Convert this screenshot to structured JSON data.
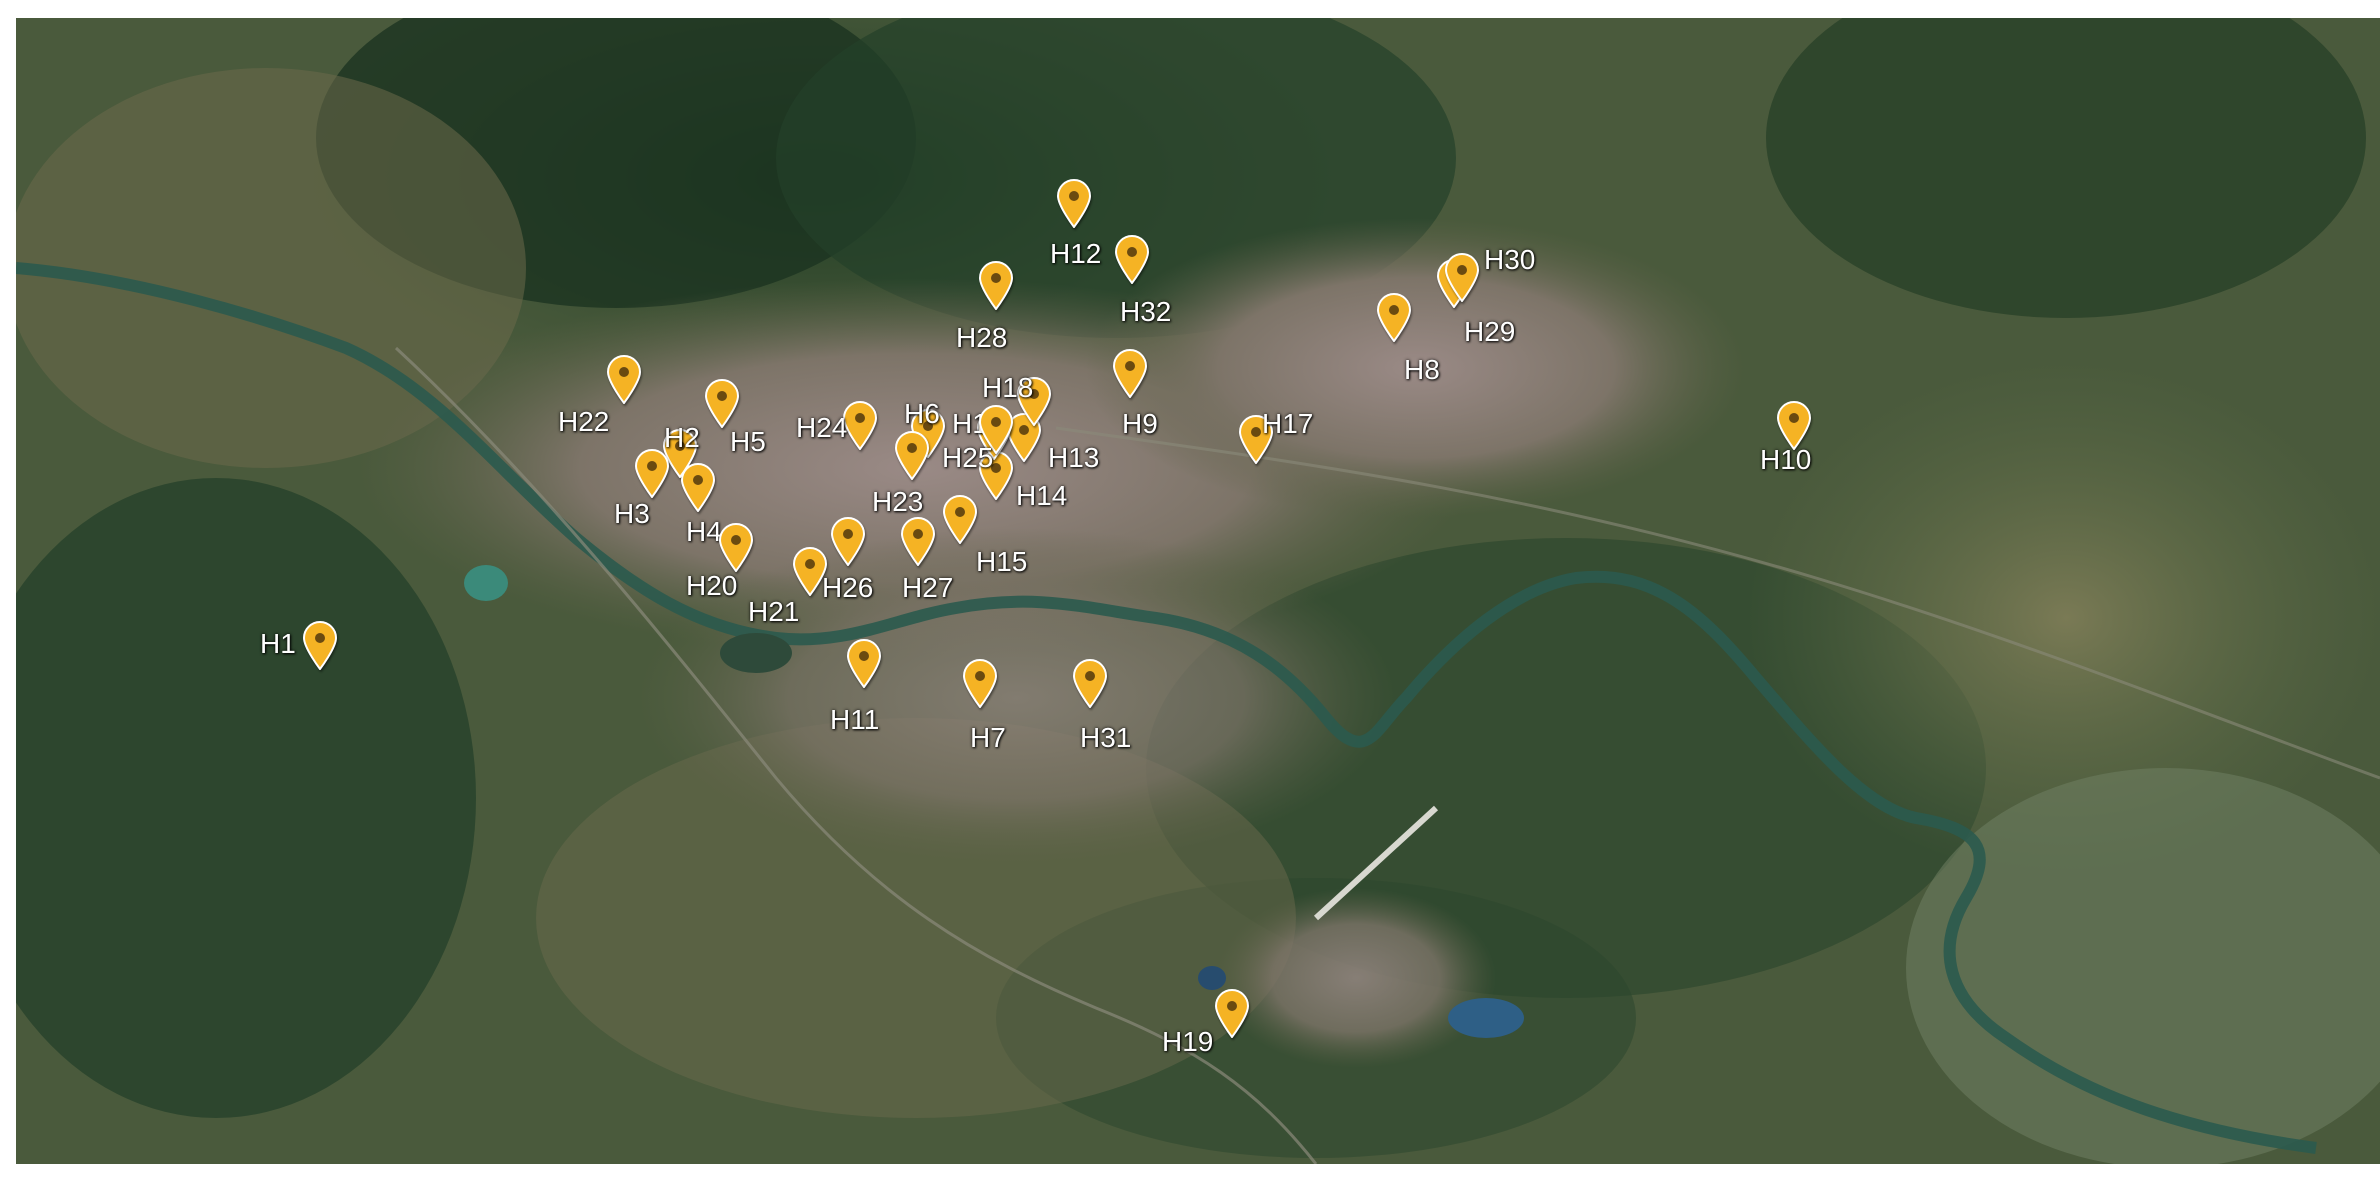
{
  "map": {
    "view": "satellite",
    "colors": {
      "marker_fill": "#f5b324",
      "marker_dot": "#6a4a10",
      "label_text": "#ffffff",
      "river": "#2b5a4e"
    },
    "markers": [
      {
        "id": "H1",
        "label": "H1"
      },
      {
        "id": "H2",
        "label": "H2"
      },
      {
        "id": "H3",
        "label": "H3"
      },
      {
        "id": "H4",
        "label": "H4"
      },
      {
        "id": "H5",
        "label": "H5"
      },
      {
        "id": "H6",
        "label": "H6"
      },
      {
        "id": "H7",
        "label": "H7"
      },
      {
        "id": "H8",
        "label": "H8"
      },
      {
        "id": "H9",
        "label": "H9"
      },
      {
        "id": "H10",
        "label": "H10"
      },
      {
        "id": "H11",
        "label": "H11"
      },
      {
        "id": "H12",
        "label": "H12"
      },
      {
        "id": "H13",
        "label": "H13"
      },
      {
        "id": "H14",
        "label": "H14"
      },
      {
        "id": "H15",
        "label": "H15"
      },
      {
        "id": "H16",
        "label": "H16"
      },
      {
        "id": "H17",
        "label": "H17"
      },
      {
        "id": "H18",
        "label": "H18"
      },
      {
        "id": "H19",
        "label": "H19"
      },
      {
        "id": "H20",
        "label": "H20"
      },
      {
        "id": "H21",
        "label": "H21"
      },
      {
        "id": "H22",
        "label": "H22"
      },
      {
        "id": "H23",
        "label": "H23"
      },
      {
        "id": "H24",
        "label": "H24"
      },
      {
        "id": "H25",
        "label": "H25"
      },
      {
        "id": "H26",
        "label": "H26"
      },
      {
        "id": "H27",
        "label": "H27"
      },
      {
        "id": "H28",
        "label": "H28"
      },
      {
        "id": "H29",
        "label": "H29"
      },
      {
        "id": "H30",
        "label": "H30"
      },
      {
        "id": "H31",
        "label": "H31"
      },
      {
        "id": "H32",
        "label": "H32"
      }
    ]
  }
}
